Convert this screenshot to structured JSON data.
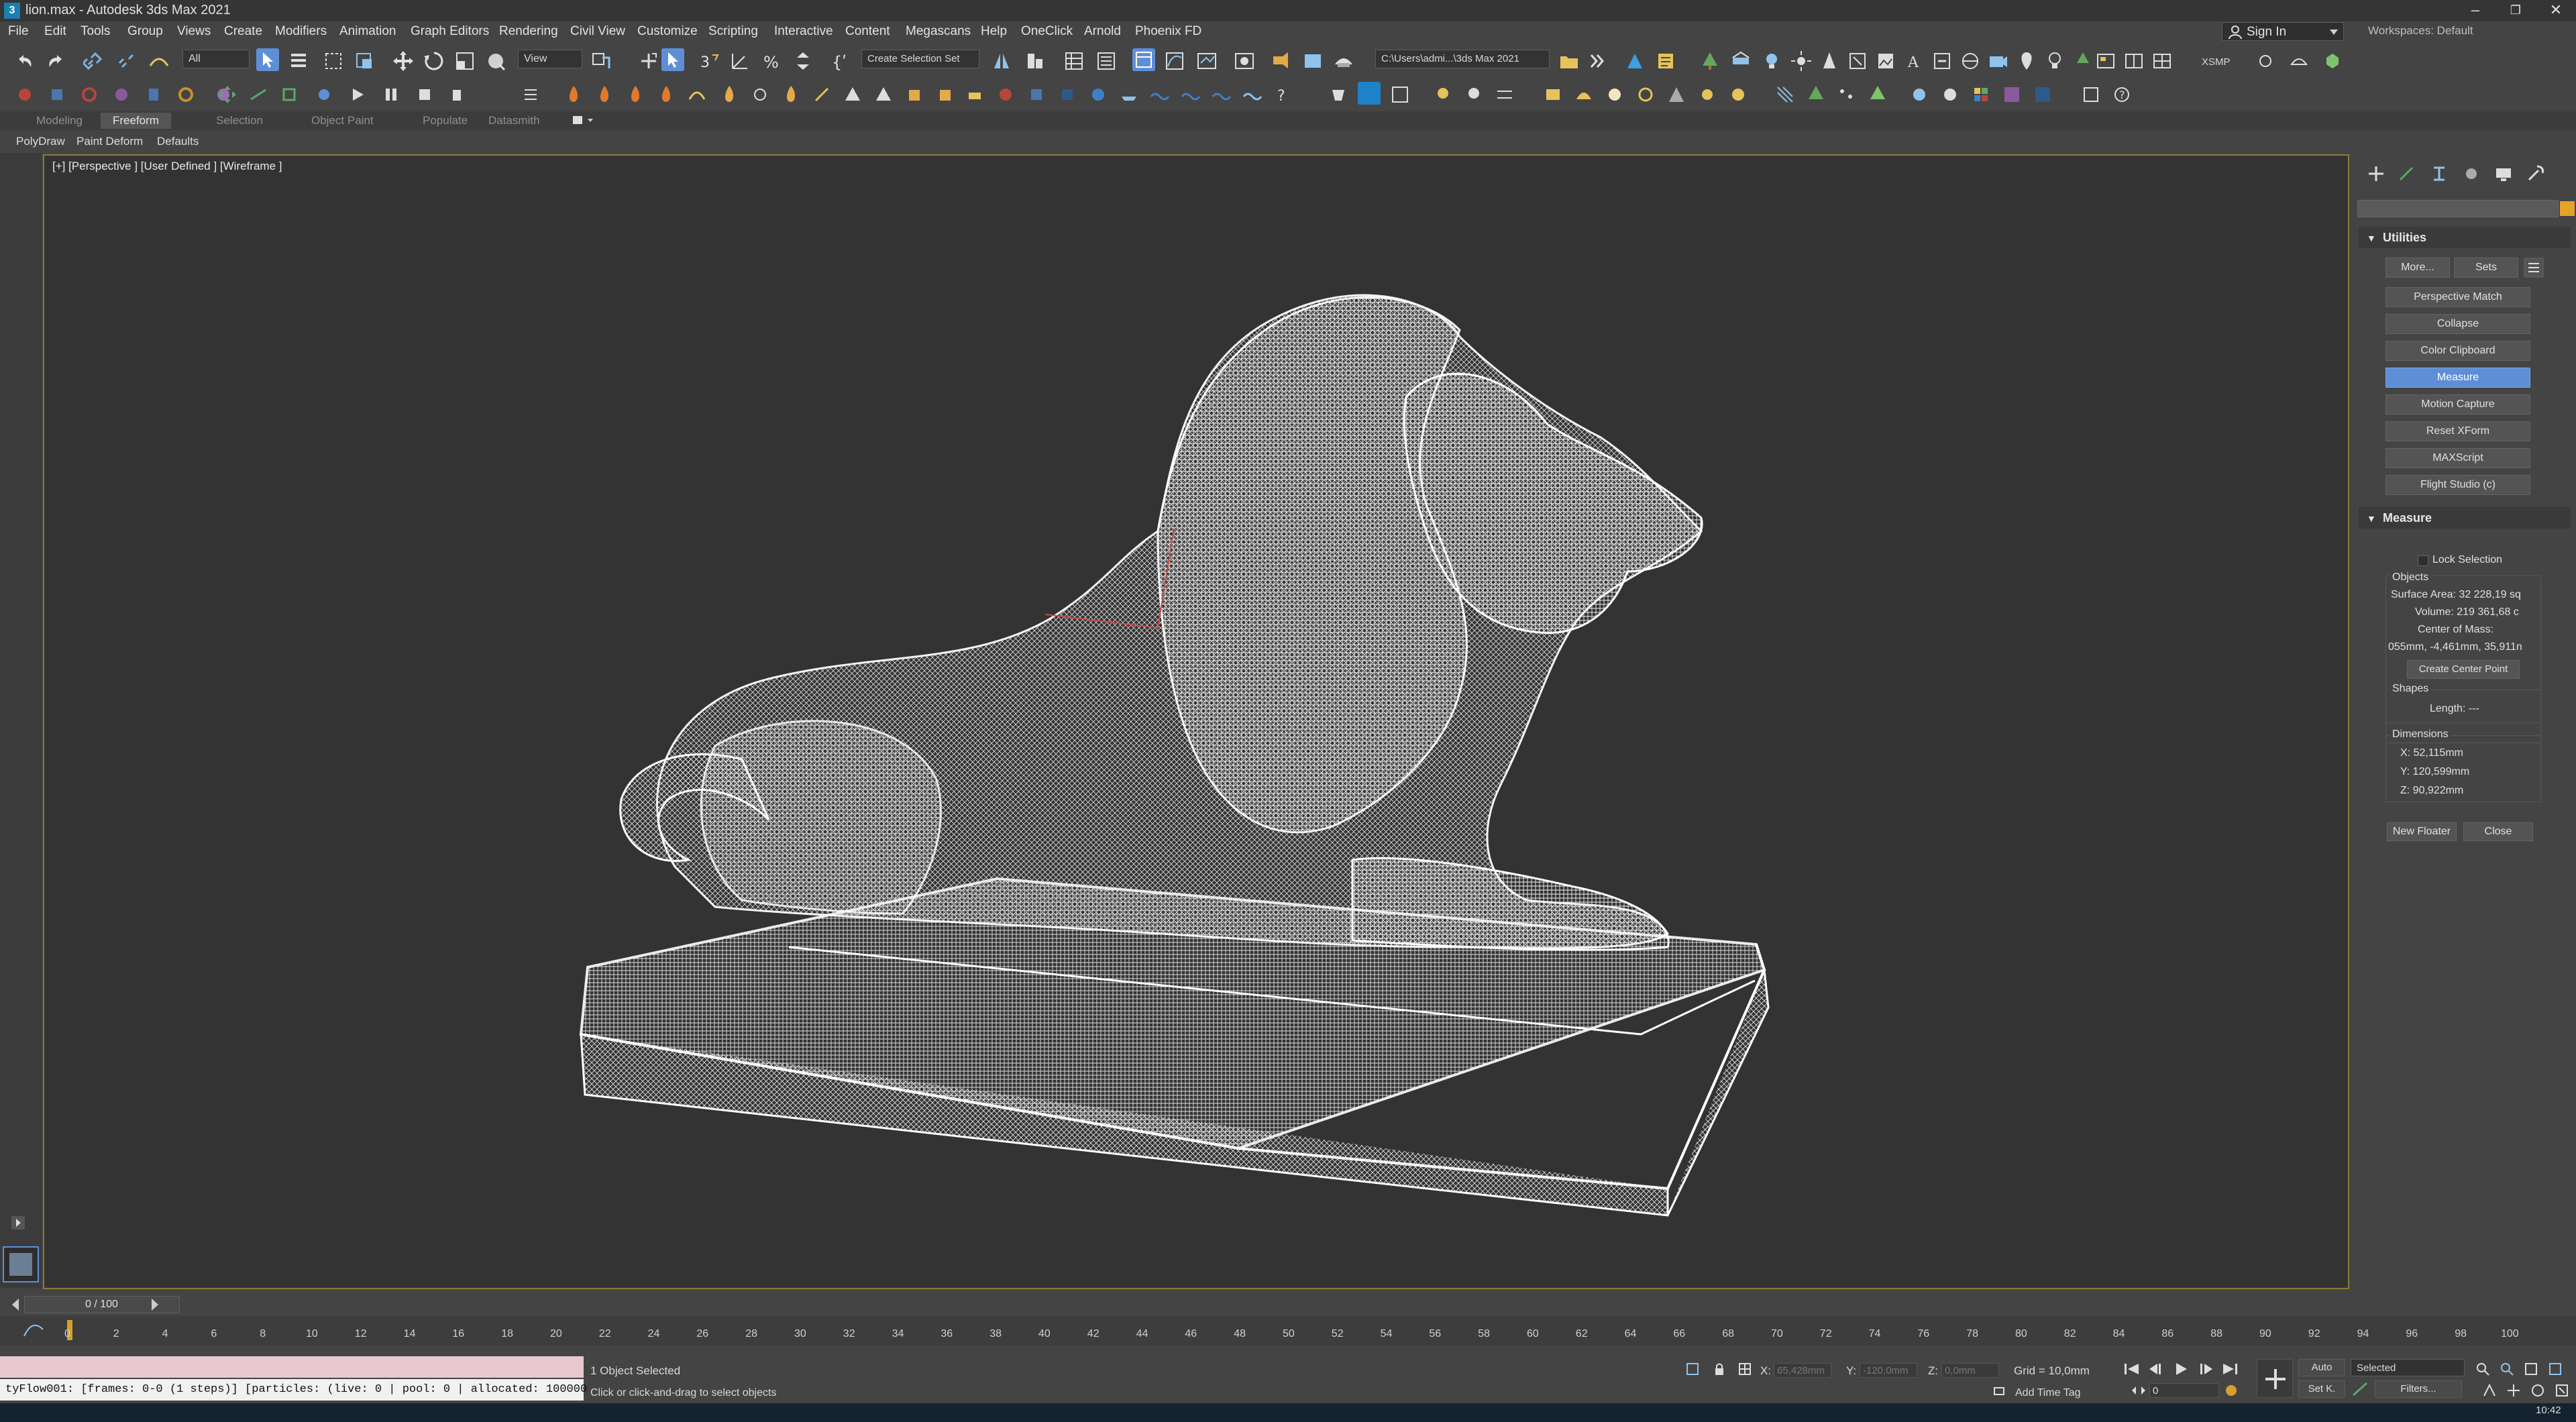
{
  "window": {
    "title": "lion.max - Autodesk 3ds Max 2021",
    "minimize": "–",
    "maximize": "❐",
    "close": "✕"
  },
  "menu": [
    "File",
    "Edit",
    "Tools",
    "Group",
    "Views",
    "Create",
    "Modifiers",
    "Animation",
    "Graph Editors",
    "Rendering",
    "Civil View",
    "Customize",
    "Scripting",
    "Interactive",
    "Content",
    "Megascans",
    "Help",
    "OneClick",
    "Arnold",
    "Phoenix FD"
  ],
  "account": {
    "sign_in": "Sign In",
    "workspaces": "Workspaces: Default"
  },
  "toolbar": {
    "filter": "All",
    "ref_coord": "View",
    "selection_set": "Create Selection Set",
    "project_path": "C:\\Users\\admi...\\3ds Max 2021",
    "xsmp": "XSMP"
  },
  "ribbon": {
    "tabs": [
      "Modeling",
      "Freeform",
      "Selection",
      "Object Paint",
      "Populate",
      "Datasmith"
    ],
    "active": "Freeform",
    "subtabs": [
      "PolyDraw",
      "Paint Deform",
      "Defaults"
    ]
  },
  "viewport": {
    "label": "[+] [Perspective ] [User Defined ] [Wireframe ]"
  },
  "command_panel": {
    "utilities_title": "Utilities",
    "more": "More...",
    "sets": "Sets",
    "buttons": [
      "Perspective Match",
      "Collapse",
      "Color Clipboard",
      "Measure",
      "Motion Capture",
      "Reset XForm",
      "MAXScript",
      "Flight Studio (c)"
    ],
    "active_button": "Measure",
    "measure": {
      "title": "Measure",
      "lock_selection": "Lock Selection",
      "objects_label": "Objects",
      "surface_area": "Surface Area: 32 228,19 sq",
      "volume": "Volume: 219 361,68 c",
      "center_of_mass_label": "Center of Mass:",
      "center_of_mass": "055mm, -4,461mm, 35,911n",
      "create_center_point": "Create Center Point",
      "shapes_label": "Shapes",
      "length": "Length: ---",
      "dimensions_label": "Dimensions",
      "dim_x": "X:  52,115mm",
      "dim_y": "Y:  120,599mm",
      "dim_z": "Z:  90,922mm",
      "new_floater": "New Floater",
      "close": "Close"
    }
  },
  "timeline": {
    "slider": "0 / 100",
    "ticks": [
      "0",
      "2",
      "4",
      "6",
      "8",
      "10",
      "12",
      "14",
      "16",
      "18",
      "20",
      "22",
      "24",
      "26",
      "28",
      "30",
      "32",
      "34",
      "36",
      "38",
      "40",
      "42",
      "44",
      "46",
      "48",
      "50",
      "52",
      "54",
      "56",
      "58",
      "60",
      "62",
      "64",
      "66",
      "68",
      "70",
      "72",
      "74",
      "76",
      "78",
      "80",
      "82",
      "84",
      "86",
      "88",
      "90",
      "92",
      "94",
      "96",
      "98",
      "100"
    ]
  },
  "status": {
    "listener_output": "tyFlow001: [frames: 0-0 (1 steps)] [particles: (live: 0 | pool: 0 | allocated: 100000",
    "selected": "1 Object Selected",
    "prompt": "Click or click-and-drag to select objects",
    "x_label": "X:",
    "x_value": "65,428mm",
    "y_label": "Y:",
    "y_value": "-120,0mm",
    "z_label": "Z:",
    "z_value": "0,0mm",
    "grid": "Grid = 10,0mm",
    "add_time_tag": "Add Time Tag",
    "auto": "Auto",
    "set_key": "Set K.",
    "key_filter": "Selected",
    "filters": "Filters...",
    "frame": "0",
    "clock": "10:42"
  },
  "colors": {
    "accent": "#5e8fd6",
    "viewport_border": "#8d7a38",
    "wire": "#f2f2f2"
  }
}
